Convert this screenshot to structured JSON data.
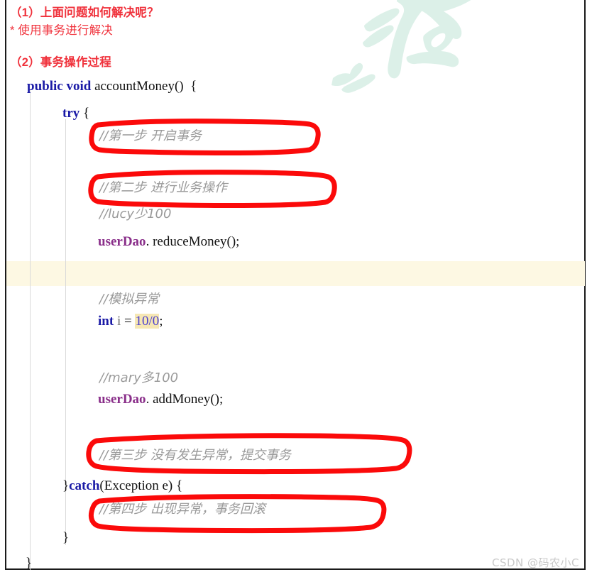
{
  "meta": {
    "watermark_color": "#dcf0e8",
    "accent_red": "#f0323c",
    "annotation_red": "#fb0a0a",
    "keyword_blue": "#1a1aa6",
    "field_purple": "#8a2f8a",
    "comment_gray": "#9a9a9a",
    "highlight_line_bg": "#fdf8e3",
    "number_highlight_bg": "#f6e7b4",
    "frame_border": "#1a1a1a"
  },
  "header": {
    "line1": "（1）上面问题如何解决呢？",
    "line2": "* 使用事务进行解决",
    "line3": "（2）事务操作过程"
  },
  "code": {
    "signature": {
      "kw_public": "public",
      "kw_void": "void",
      "method_name": "accountMoney",
      "parens": "()",
      "brace": "{"
    },
    "try_line": {
      "keyword": "try",
      "brace": "{"
    },
    "comment_step1": "//第一步 开启事务",
    "comment_step2": "//第二步 进行业务操作",
    "comment_lucy": "//lucy少100",
    "stmt_reduce": {
      "field": "userDao",
      "dot": ".",
      "method": "reduceMoney",
      "tail": "();"
    },
    "comment_mock_exception": "//模拟异常",
    "stmt_int": {
      "keyword": "int",
      "var": "i",
      "equals": "=",
      "value": "10/0",
      "semicolon": ";"
    },
    "comment_mary": "//mary多100",
    "stmt_add": {
      "field": "userDao",
      "dot": ".",
      "method": "addMoney",
      "tail": "();"
    },
    "comment_step3": "//第三步 没有发生异常，提交事务",
    "catch_line": {
      "close_brace": "}",
      "keyword": "catch",
      "params": "(Exception e)",
      "open_brace": "{"
    },
    "comment_step4": "//第四步 出现异常，事务回滚",
    "close_inner": "}",
    "close_outer": "}"
  },
  "annotations": {
    "box1_label": "step-1-start-transaction",
    "box2_label": "step-2-business-operation",
    "box3_label": "step-3-commit-transaction",
    "box4_label": "step-4-rollback-transaction"
  },
  "watermark": {
    "text": "之石"
  },
  "footer": {
    "signature": "CSDN @码农小C"
  }
}
